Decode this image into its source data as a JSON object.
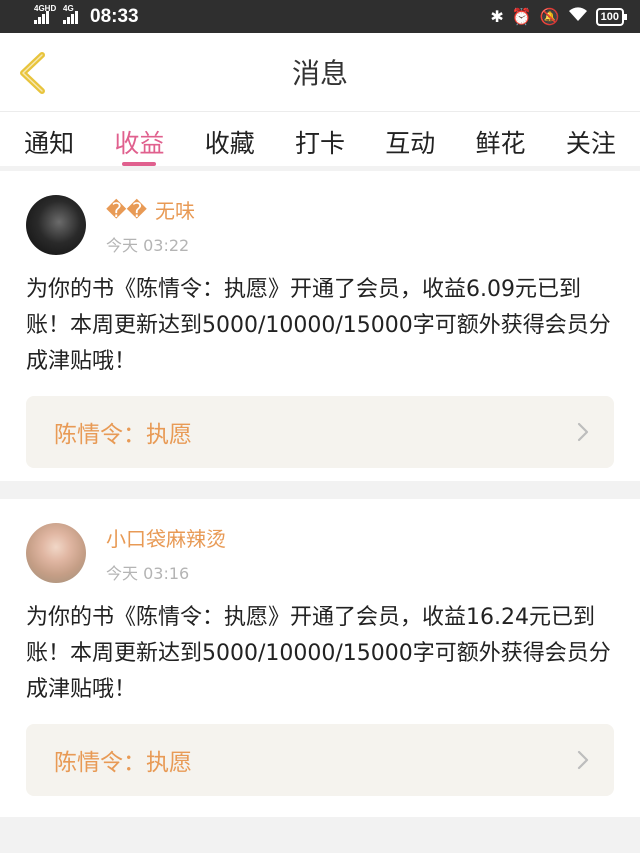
{
  "status_bar": {
    "network1": "4GHD",
    "network2": "4G",
    "time": "08:33",
    "battery": "100"
  },
  "header": {
    "title": "消息"
  },
  "tabs": [
    {
      "label": "通知"
    },
    {
      "label": "收益",
      "active": true
    },
    {
      "label": "收藏"
    },
    {
      "label": "打卡"
    },
    {
      "label": "互动"
    },
    {
      "label": "鲜花"
    },
    {
      "label": "关注"
    }
  ],
  "messages": [
    {
      "user_prefix": "��",
      "user": "无味",
      "time": "今天 03:22",
      "text": "为你的书《陈情令：执愿》开通了会员，收益6.09元已到账！本周更新达到5000/10000/15000字可额外获得会员分成津贴哦！",
      "book": "陈情令：执愿"
    },
    {
      "user": "小口袋麻辣烫",
      "time": "今天 03:16",
      "text": "为你的书《陈情令：执愿》开通了会员，收益16.24元已到账！本周更新达到5000/10000/15000字可额外获得会员分成津贴哦！",
      "book": "陈情令：执愿"
    }
  ],
  "colors": {
    "accent": "#e0608e",
    "orange": "#e89a55",
    "back_icon": "#e8c43c"
  },
  "icons": {
    "back": "chevron-left-icon",
    "arrow": "chevron-right-icon"
  }
}
